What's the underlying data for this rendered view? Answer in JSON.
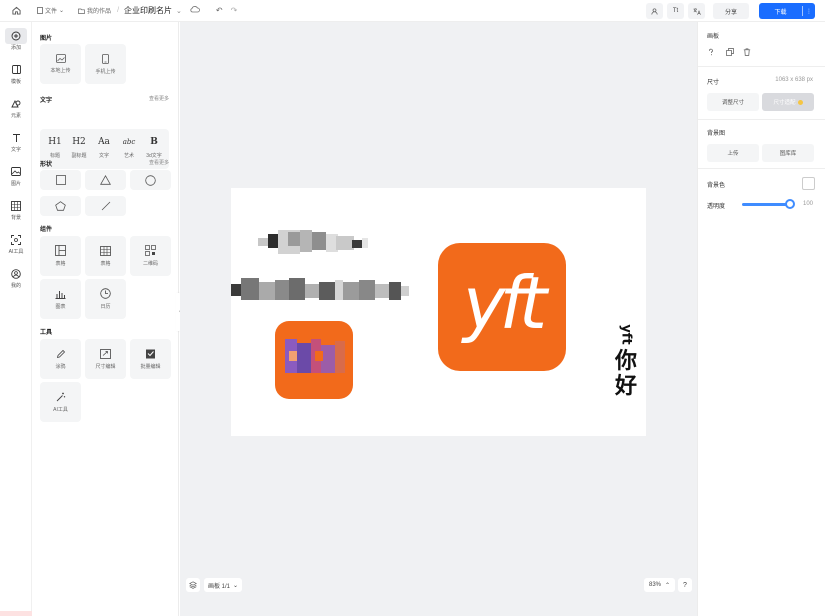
{
  "topbar": {
    "file_menu": "文件",
    "my_works": "我的作品",
    "separator": "/",
    "document_title": "企业印刷名片",
    "share_label": "分享",
    "download_label": "下载",
    "text_tool_label": "Tt"
  },
  "rail": {
    "items": [
      {
        "label": "添加",
        "icon": "plus-circle-icon"
      },
      {
        "label": "模板",
        "icon": "template-icon"
      },
      {
        "label": "元素",
        "icon": "shapes-icon"
      },
      {
        "label": "文字",
        "icon": "text-icon"
      },
      {
        "label": "图片",
        "icon": "image-icon"
      },
      {
        "label": "背景",
        "icon": "background-icon"
      },
      {
        "label": "AI工具",
        "icon": "ai-scan-icon"
      },
      {
        "label": "我的",
        "icon": "user-icon"
      }
    ]
  },
  "panel": {
    "images": {
      "heading": "图片",
      "local_upload": "本地上传",
      "phone_upload": "手机上传"
    },
    "text": {
      "heading": "文字",
      "more": "查看更多",
      "items": [
        {
          "glyph": "H1",
          "label": "标题"
        },
        {
          "glyph": "H2",
          "label": "副标题"
        },
        {
          "glyph": "Aa",
          "label": "文字"
        },
        {
          "glyph": "abc",
          "label": "艺术"
        },
        {
          "glyph": "B",
          "label": "3d文字"
        }
      ]
    },
    "shapes": {
      "heading": "形状",
      "more": "查看更多"
    },
    "components": {
      "heading": "组件",
      "items": [
        "表格",
        "表格",
        "二维码",
        "图表",
        "日历"
      ]
    },
    "tools": {
      "heading": "工具",
      "items": [
        "涂鸦",
        "尺寸编辑",
        "批量编辑",
        "AI工具"
      ]
    }
  },
  "canvas": {
    "logo_text": "yft",
    "vertical_text_latin": "yft",
    "vertical_text_cjk_1": "你",
    "vertical_text_cjk_2": "好"
  },
  "footer": {
    "page_label": "画板 1/1",
    "zoom": "83%",
    "help": "?"
  },
  "right_panel": {
    "artboard_heading": "画板",
    "size_label": "尺寸",
    "size_value": "1063 x 638 px",
    "resize_button": "调整尺寸",
    "smart_resize_button": "尺寸适配",
    "bg_image_label": "背景图",
    "upload_button": "上传",
    "library_button": "图库库",
    "bg_color_label": "背景色",
    "opacity_label": "透明度",
    "opacity_value": "100"
  },
  "colors": {
    "accent": "#1a6dff",
    "logo_orange": "#f26a1b",
    "canvas_bg": "#f0f1f3"
  }
}
